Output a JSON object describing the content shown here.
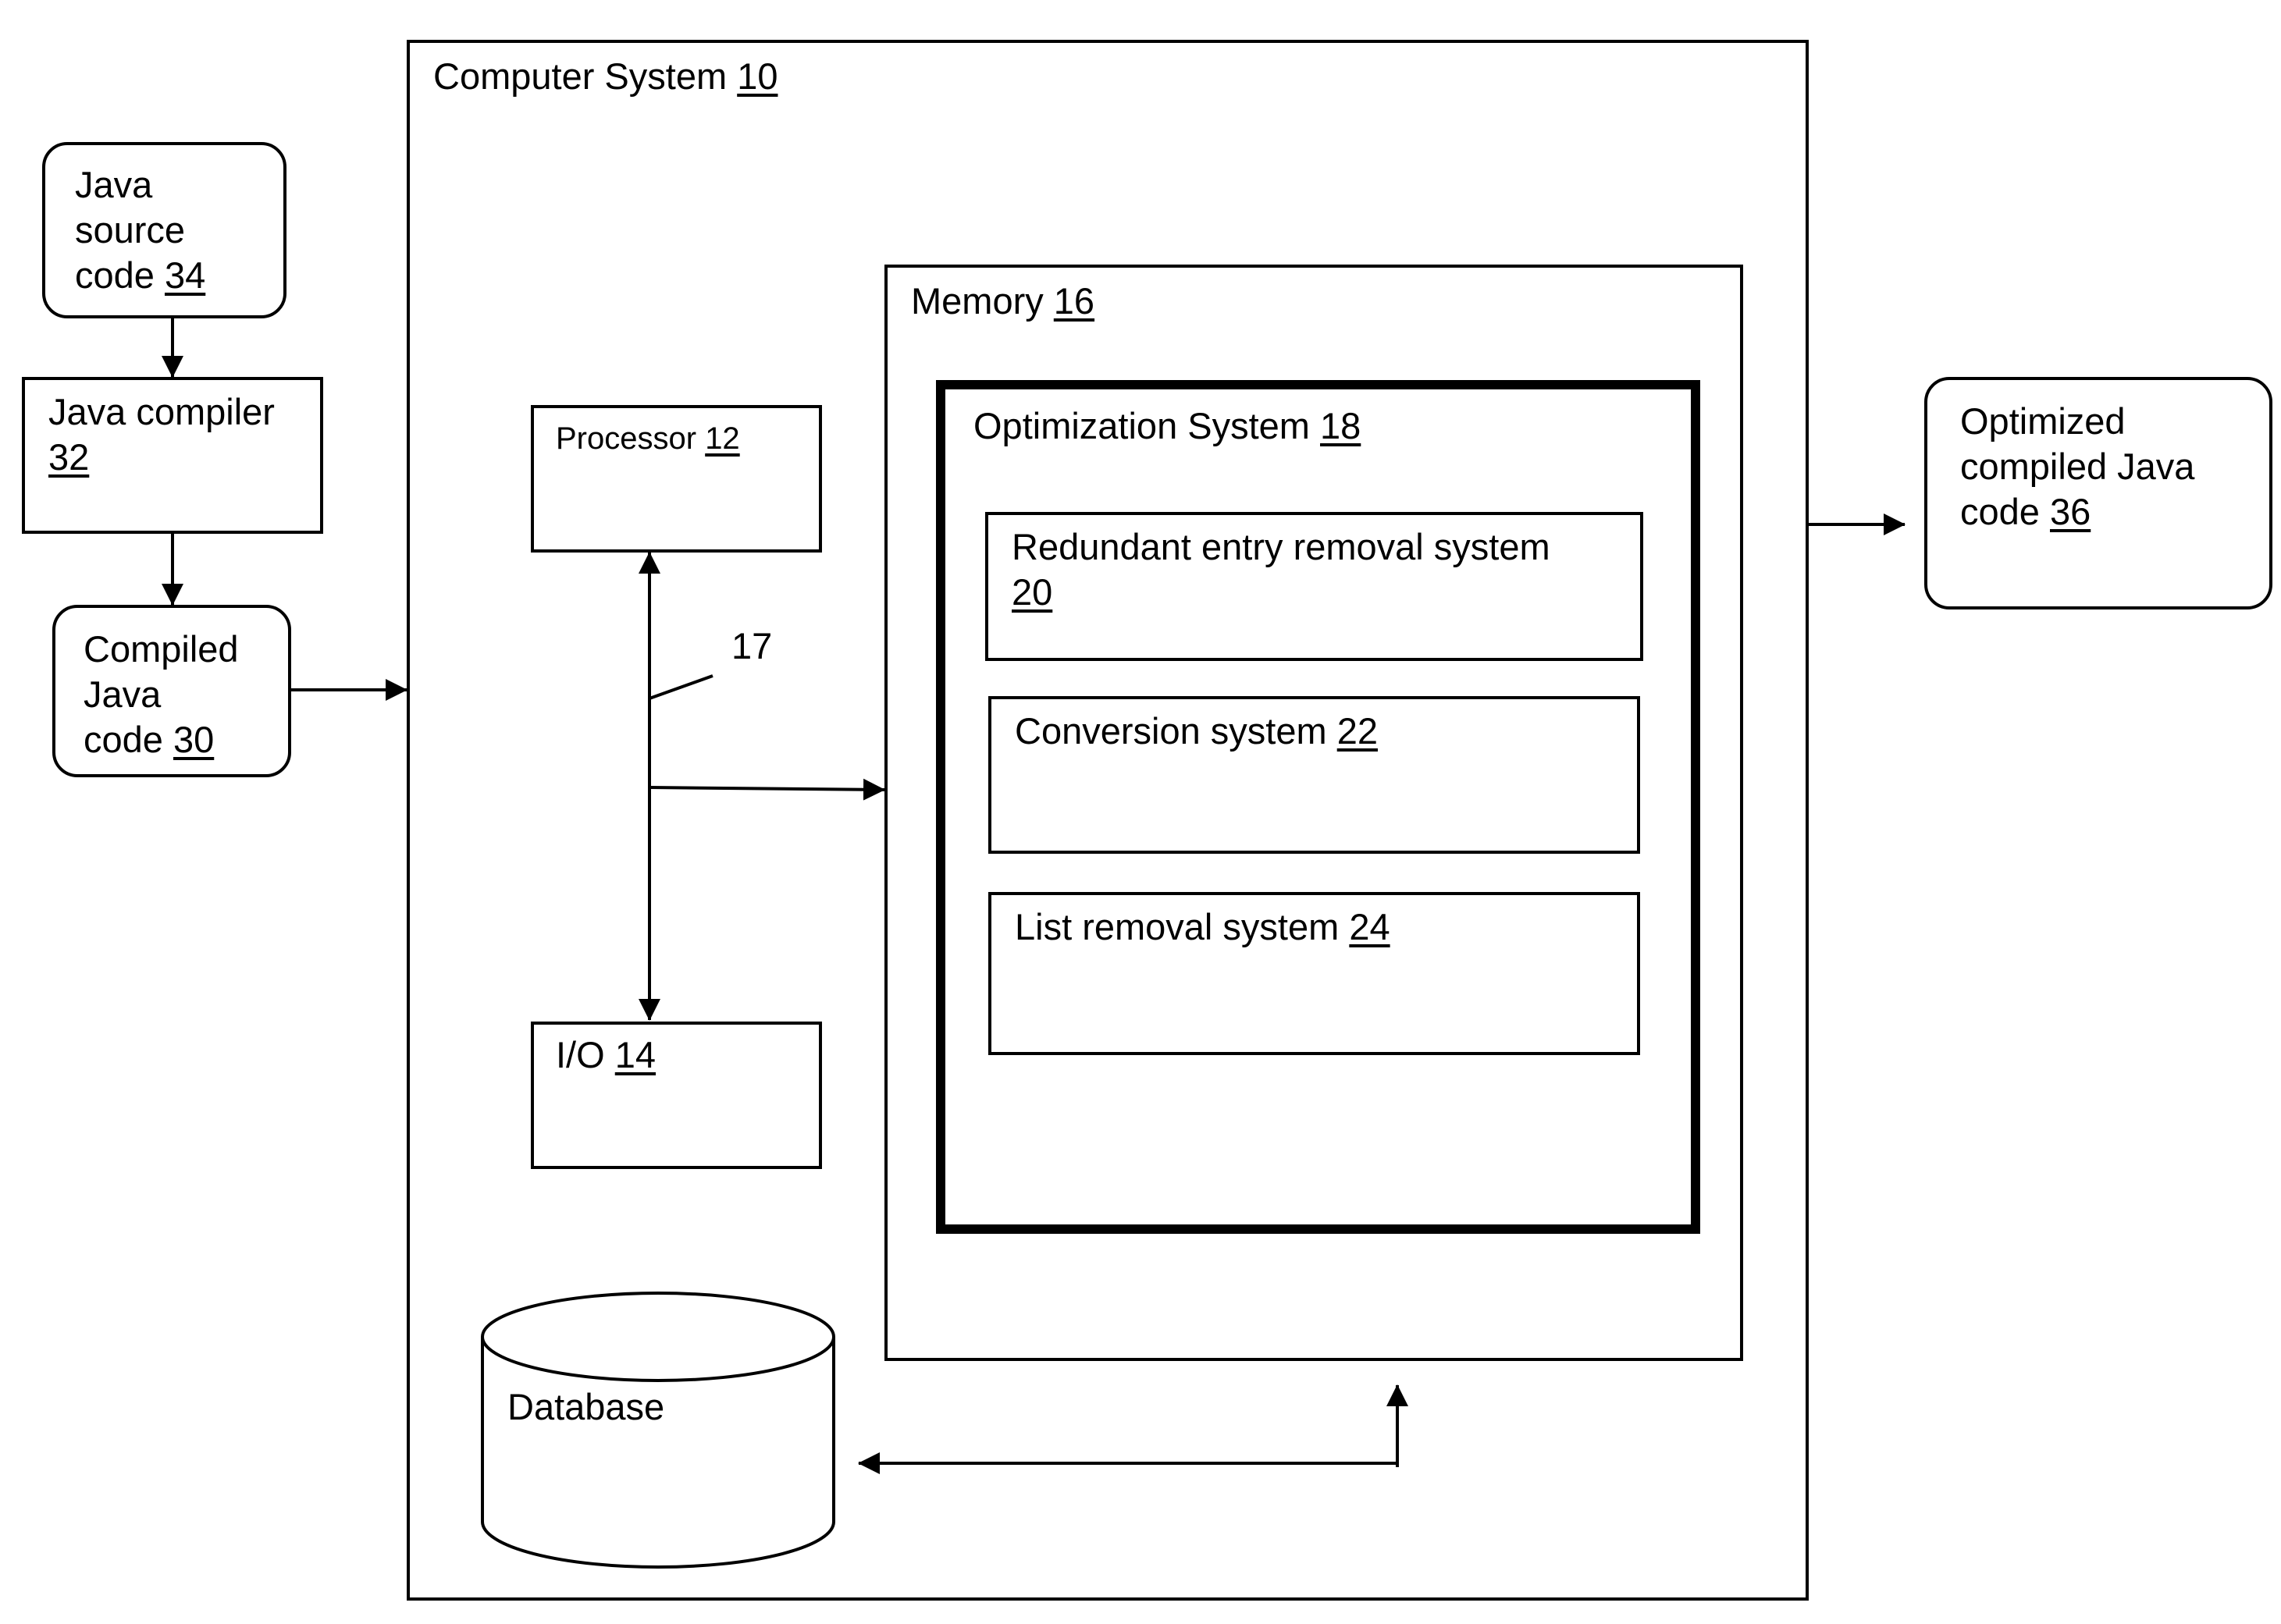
{
  "diagram": {
    "computer_system": {
      "label": "Computer System",
      "ref": "10"
    },
    "memory": {
      "label": "Memory",
      "ref": "16"
    },
    "optimization_system": {
      "label": "Optimization System",
      "ref": "18"
    },
    "redundant_entry_removal": {
      "label": "Redundant entry removal system",
      "ref": "20"
    },
    "conversion_system": {
      "label": "Conversion system",
      "ref": "22"
    },
    "list_removal_system": {
      "label": "List removal system",
      "ref": "24"
    },
    "processor": {
      "label": "Processor",
      "ref": "12"
    },
    "io": {
      "label": "I/O",
      "ref": "14"
    },
    "bus": {
      "ref": "17"
    },
    "database": {
      "label": "Database"
    },
    "java_source": {
      "label": "Java\nsource\ncode",
      "ref": "34"
    },
    "java_compiler": {
      "label": "Java compiler",
      "ref": "32"
    },
    "compiled_java": {
      "label": "Compiled\nJava\ncode",
      "ref": "30"
    },
    "optimized_java": {
      "label": "Optimized\ncompiled Java\ncode",
      "ref": "36"
    }
  }
}
